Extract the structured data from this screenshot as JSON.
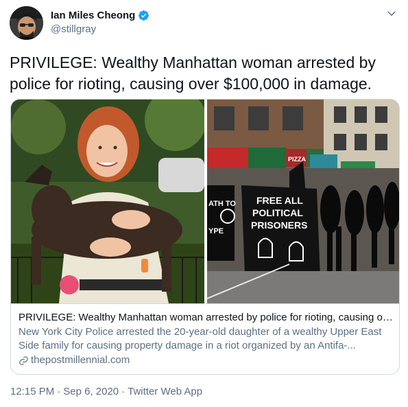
{
  "author": {
    "name": "Ian Miles Cheong",
    "handle": "@stillgray",
    "verified": true
  },
  "tweet": {
    "text": "PRIVILEGE: Wealthy Manhattan woman arrested by police for rioting, causing over $100,000 in damage."
  },
  "card": {
    "title": "PRIVILEGE: Wealthy Manhattan woman arrested by police for rioting, causing ove...",
    "description": "New York City Police arrested the 20-year-old daughter of a wealthy Upper East Side family for causing property damage in a riot organized by an Antifa-...",
    "domain": "thepostmillennial.com",
    "banner_lines": [
      "FREE ALL",
      "POLITICAL",
      "PRISONERS"
    ],
    "banner_left_lines": [
      "ATH TO",
      "YPE"
    ],
    "shop_sign": "PIZZA"
  },
  "meta": {
    "time": "12:15 PM",
    "separator": "·",
    "date": "Sep 6, 2020",
    "source": "Twitter Web App"
  },
  "colors": {
    "accent": "#1da1f2",
    "text": "#0f1419",
    "secondary": "#5b7083",
    "border": "#cfd9de"
  },
  "icons": {
    "verified": "verified-badge-icon",
    "caret": "chevron-down-icon",
    "link": "link-icon"
  }
}
